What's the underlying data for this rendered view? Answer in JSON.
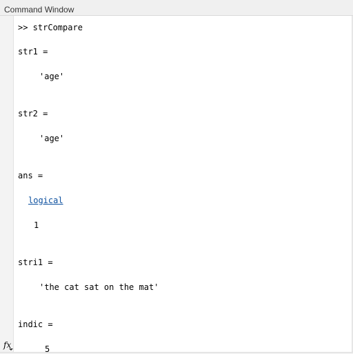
{
  "window": {
    "title": "Command Window"
  },
  "lines": {
    "cmd": ">> strCompare",
    "str1_label": "str1 =",
    "str1_value": "'age'",
    "str2_label": "str2 =",
    "str2_value": "'age'",
    "ans_label": "ans =",
    "ans_class": "logical",
    "ans_value": "1",
    "stri1_label": "stri1 =",
    "stri1_value": "'the cat sat on the mat'",
    "indic_label": "indic =",
    "indic_value": "5"
  },
  "prompt_icon": "fx-icon"
}
